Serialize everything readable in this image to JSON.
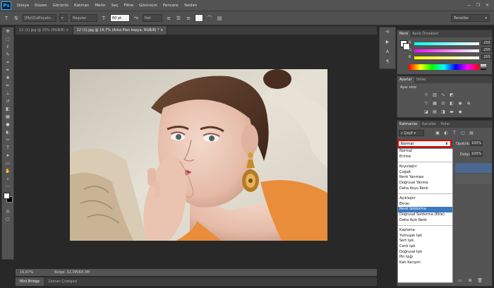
{
  "app": {
    "logo": "Ps"
  },
  "menu": [
    "Dosya",
    "Düzen",
    "Görüntü",
    "Katman",
    "Metin",
    "Seç",
    "Filtre",
    "Görünüm",
    "Pencere",
    "Yardım"
  ],
  "window_controls": [
    "—",
    "❐",
    "✕"
  ],
  "options": {
    "font_family": "[Myl]Caffeyato...",
    "font_style": "Regular",
    "font_size": "60 pt",
    "aa_label": "ªa",
    "aa_mode": "Net",
    "workspace": "Temeller"
  },
  "doc_tabs": [
    {
      "label": "12 (2).jpg @ 25% (RGB/8)",
      "active": false
    },
    {
      "label": "12 (1).jpg @ 16,7% (Arka Plan kopya, RGB/8) *",
      "active": true
    }
  ],
  "status": {
    "zoom": "16,67%",
    "doc_size": "Belge: 32,0M/64,0M"
  },
  "bottom_tabs": [
    "Mini Bridge",
    "Zaman Çizelgesi"
  ],
  "color_panel": {
    "tabs": [
      "Renk",
      "Renk Örnekleri"
    ],
    "sliders": [
      {
        "label": "R",
        "value": "255"
      },
      {
        "label": "G",
        "value": "255"
      },
      {
        "label": "B",
        "value": "255"
      }
    ]
  },
  "adjustments_panel": {
    "tabs": [
      "Ayarlar",
      "Stiller"
    ],
    "title": "Ayar ekle"
  },
  "layers_panel": {
    "tabs": [
      "Katmanlar",
      "Kanallar",
      "Yollar"
    ],
    "kind_filter": "Çeşit",
    "blend_mode": "Normal",
    "opacity_label": "Opaklık:",
    "opacity_value": "100%",
    "fill_label": "Dolgu:",
    "fill_value": "100%"
  },
  "blend_modes": [
    [
      "Normal",
      "Eritme"
    ],
    [
      "Koyulaştır",
      "Çoğalt",
      "Renk Yanması",
      "Doğrusal Yanma",
      "Daha Koyu Renk"
    ],
    [
      "Açıklaştır",
      "Ekran",
      "Renk Soldurma",
      "Doğrusal Soldurma (Ekle)",
      "Daha Açık Renk"
    ],
    [
      "Kaplama",
      "Yumuşak Işık",
      "Sert Işık",
      "Canlı Işık",
      "Doğrusal Işık",
      "Pin Işığı",
      "Katı Karışım"
    ]
  ],
  "blend_selected": "Renk Soldurma",
  "colors": {
    "highlight": "#3a78c2",
    "outline": "#d80000",
    "ui_dark": "#282828",
    "ui_panel": "#535353"
  }
}
